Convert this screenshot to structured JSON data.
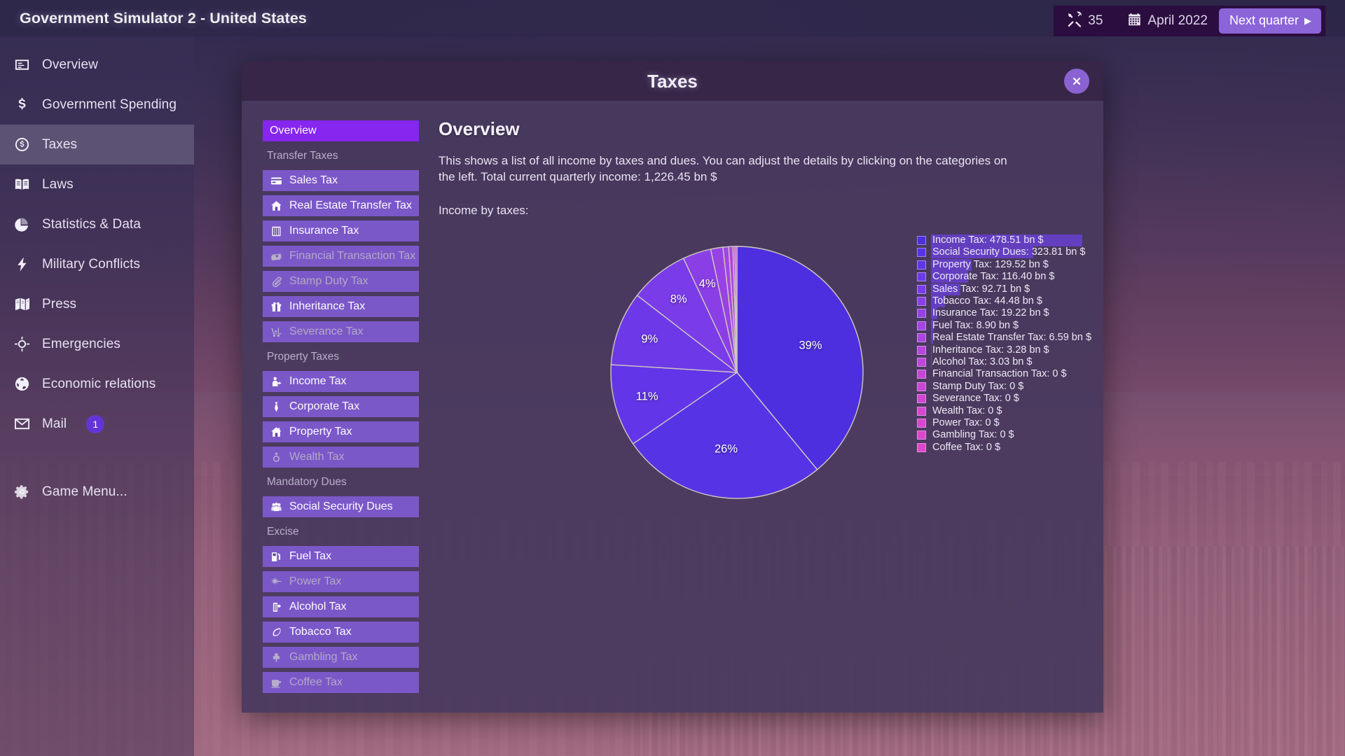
{
  "app": {
    "title": "Government Simulator 2 - United States"
  },
  "hud": {
    "tools_icon": "tools-icon",
    "tools_value": "35",
    "calendar_icon": "calendar-icon",
    "date": "April 2022",
    "next_quarter_label": "Next quarter",
    "next_quarter_arrow": "▶"
  },
  "sidebar": {
    "items": [
      {
        "label": "Overview",
        "icon": "overview-icon",
        "active": false,
        "badge": null
      },
      {
        "label": "Government Spending",
        "icon": "dollar-icon",
        "active": false,
        "badge": null
      },
      {
        "label": "Taxes",
        "icon": "coin-icon",
        "active": true,
        "badge": null
      },
      {
        "label": "Laws",
        "icon": "book-icon",
        "active": false,
        "badge": null
      },
      {
        "label": "Statistics & Data",
        "icon": "piechart-icon",
        "active": false,
        "badge": null
      },
      {
        "label": "Military Conflicts",
        "icon": "bolt-icon",
        "active": false,
        "badge": null
      },
      {
        "label": "Press",
        "icon": "map-icon",
        "active": false,
        "badge": null
      },
      {
        "label": "Emergencies",
        "icon": "target-icon",
        "active": false,
        "badge": null
      },
      {
        "label": "Economic relations",
        "icon": "globe-icon",
        "active": false,
        "badge": null
      },
      {
        "label": "Mail",
        "icon": "envelope-icon",
        "active": false,
        "badge": "1"
      }
    ],
    "game_menu": {
      "label": "Game Menu...",
      "icon": "gear-icon"
    }
  },
  "modal": {
    "title": "Taxes",
    "close_icon": "close-icon",
    "content": {
      "heading": "Overview",
      "description": "This shows a list of all income by taxes and dues. You can adjust the details by clicking on the categories on the left. Total current quarterly income: 1,226.45 bn $",
      "chart_caption": "Income by taxes:"
    },
    "categories": [
      {
        "type": "item",
        "label": "Overview",
        "icon": null,
        "selected": true,
        "disabled": false
      },
      {
        "type": "group",
        "label": "Transfer Taxes"
      },
      {
        "type": "item",
        "label": "Sales Tax",
        "icon": "card-icon",
        "selected": false,
        "disabled": false
      },
      {
        "type": "item",
        "label": "Real Estate Transfer Tax",
        "icon": "house-icon",
        "selected": false,
        "disabled": false
      },
      {
        "type": "item",
        "label": "Insurance Tax",
        "icon": "building-icon",
        "selected": false,
        "disabled": false
      },
      {
        "type": "item",
        "label": "Financial Transaction Tax",
        "icon": "banknotes-icon",
        "selected": false,
        "disabled": true
      },
      {
        "type": "item",
        "label": "Stamp Duty Tax",
        "icon": "paperclip-icon",
        "selected": false,
        "disabled": true
      },
      {
        "type": "item",
        "label": "Inheritance Tax",
        "icon": "gift-icon",
        "selected": false,
        "disabled": false
      },
      {
        "type": "item",
        "label": "Severance Tax",
        "icon": "forklift-icon",
        "selected": false,
        "disabled": true
      },
      {
        "type": "group",
        "label": "Property Taxes"
      },
      {
        "type": "item",
        "label": "Income Tax",
        "icon": "person-icon",
        "selected": false,
        "disabled": false
      },
      {
        "type": "item",
        "label": "Corporate Tax",
        "icon": "tie-icon",
        "selected": false,
        "disabled": false
      },
      {
        "type": "item",
        "label": "Property Tax",
        "icon": "home-icon",
        "selected": false,
        "disabled": false
      },
      {
        "type": "item",
        "label": "Wealth Tax",
        "icon": "ring-icon",
        "selected": false,
        "disabled": true
      },
      {
        "type": "group",
        "label": "Mandatory Dues"
      },
      {
        "type": "item",
        "label": "Social Security Dues",
        "icon": "people-icon",
        "selected": false,
        "disabled": false
      },
      {
        "type": "group",
        "label": "Excise"
      },
      {
        "type": "item",
        "label": "Fuel Tax",
        "icon": "fuelpump-icon",
        "selected": false,
        "disabled": false
      },
      {
        "type": "item",
        "label": "Power Tax",
        "icon": "spark-icon",
        "selected": false,
        "disabled": true
      },
      {
        "type": "item",
        "label": "Alcohol Tax",
        "icon": "beer-icon",
        "selected": false,
        "disabled": false
      },
      {
        "type": "item",
        "label": "Tobacco Tax",
        "icon": "leaf-icon",
        "selected": false,
        "disabled": false
      },
      {
        "type": "item",
        "label": "Gambling Tax",
        "icon": "club-icon",
        "selected": false,
        "disabled": true
      },
      {
        "type": "item",
        "label": "Coffee Tax",
        "icon": "coffee-icon",
        "selected": false,
        "disabled": true
      }
    ]
  },
  "chart_data": {
    "type": "pie",
    "title": "Income by taxes:",
    "unit": "bn $",
    "total": "1,226.45 bn $",
    "total_value": 1226.45,
    "start_angle_deg": 0,
    "direction": "counterclockwise",
    "categories": [
      "Income Tax",
      "Social Security Dues",
      "Property Tax",
      "Corporate Tax",
      "Sales Tax",
      "Tobacco Tax",
      "Insurance Tax",
      "Fuel Tax",
      "Real Estate Transfer Tax",
      "Inheritance Tax",
      "Alcohol Tax",
      "Financial Transaction Tax",
      "Stamp Duty Tax",
      "Severance Tax",
      "Wealth Tax",
      "Power Tax",
      "Gambling Tax",
      "Coffee Tax"
    ],
    "values": [
      478.51,
      323.81,
      129.52,
      116.4,
      92.71,
      44.48,
      19.22,
      8.9,
      6.59,
      3.28,
      3.03,
      0,
      0,
      0,
      0,
      0,
      0,
      0
    ],
    "value_labels": [
      "478.51 bn $",
      "323.81 bn $",
      "129.52 bn $",
      "116.40 bn $",
      "92.71 bn $",
      "44.48 bn $",
      "19.22 bn $",
      "8.90 bn $",
      "6.59 bn $",
      "3.28 bn $",
      "3.03 bn $",
      "0 $",
      "0 $",
      "0 $",
      "0 $",
      "0 $",
      "0 $",
      "0 $"
    ],
    "slice_percent_labels": [
      "39%",
      "26%",
      "11%",
      "9%",
      "8%",
      "4%"
    ],
    "colors": [
      "#4d2fe0",
      "#5733e6",
      "#6236e8",
      "#6d39e8",
      "#7a3ce8",
      "#8a3fe6",
      "#9842e4",
      "#a544e2",
      "#ae44e0",
      "#b745dd",
      "#bf46da",
      "#c646d8",
      "#cc46d6",
      "#d246d4",
      "#d746d2",
      "#db46d0",
      "#df45ce",
      "#e245cc"
    ],
    "legend": [
      {
        "label": "Income Tax",
        "value_text": "478.51 bn $",
        "value": 478.51,
        "color": "#4d2fe0"
      },
      {
        "label": "Social Security Dues",
        "value_text": "323.81 bn $",
        "value": 323.81,
        "color": "#5733e6"
      },
      {
        "label": "Property Tax",
        "value_text": "129.52 bn $",
        "value": 129.52,
        "color": "#6236e8"
      },
      {
        "label": "Corporate Tax",
        "value_text": "116.40 bn $",
        "value": 116.4,
        "color": "#6d39e8"
      },
      {
        "label": "Sales Tax",
        "value_text": "92.71 bn $",
        "value": 92.71,
        "color": "#7a3ce8"
      },
      {
        "label": "Tobacco Tax",
        "value_text": "44.48 bn $",
        "value": 44.48,
        "color": "#8a3fe6"
      },
      {
        "label": "Insurance Tax",
        "value_text": "19.22 bn $",
        "value": 19.22,
        "color": "#9842e4"
      },
      {
        "label": "Fuel Tax",
        "value_text": "8.90 bn $",
        "value": 8.9,
        "color": "#a544e2"
      },
      {
        "label": "Real Estate Transfer Tax",
        "value_text": "6.59 bn $",
        "value": 6.59,
        "color": "#ae44e0"
      },
      {
        "label": "Inheritance Tax",
        "value_text": "3.28 bn $",
        "value": 3.28,
        "color": "#b745dd"
      },
      {
        "label": "Alcohol Tax",
        "value_text": "3.03 bn $",
        "value": 3.03,
        "color": "#bf46da"
      },
      {
        "label": "Financial Transaction Tax",
        "value_text": "0 $",
        "value": 0,
        "color": "#c646d8"
      },
      {
        "label": "Stamp Duty Tax",
        "value_text": "0 $",
        "value": 0,
        "color": "#cc46d6"
      },
      {
        "label": "Severance Tax",
        "value_text": "0 $",
        "value": 0,
        "color": "#d246d4"
      },
      {
        "label": "Wealth Tax",
        "value_text": "0 $",
        "value": 0,
        "color": "#d746d2"
      },
      {
        "label": "Power Tax",
        "value_text": "0 $",
        "value": 0,
        "color": "#db46d0"
      },
      {
        "label": "Gambling Tax",
        "value_text": "0 $",
        "value": 0,
        "color": "#df45ce"
      },
      {
        "label": "Coffee Tax",
        "value_text": "0 $",
        "value": 0,
        "color": "#e245cc"
      }
    ]
  }
}
